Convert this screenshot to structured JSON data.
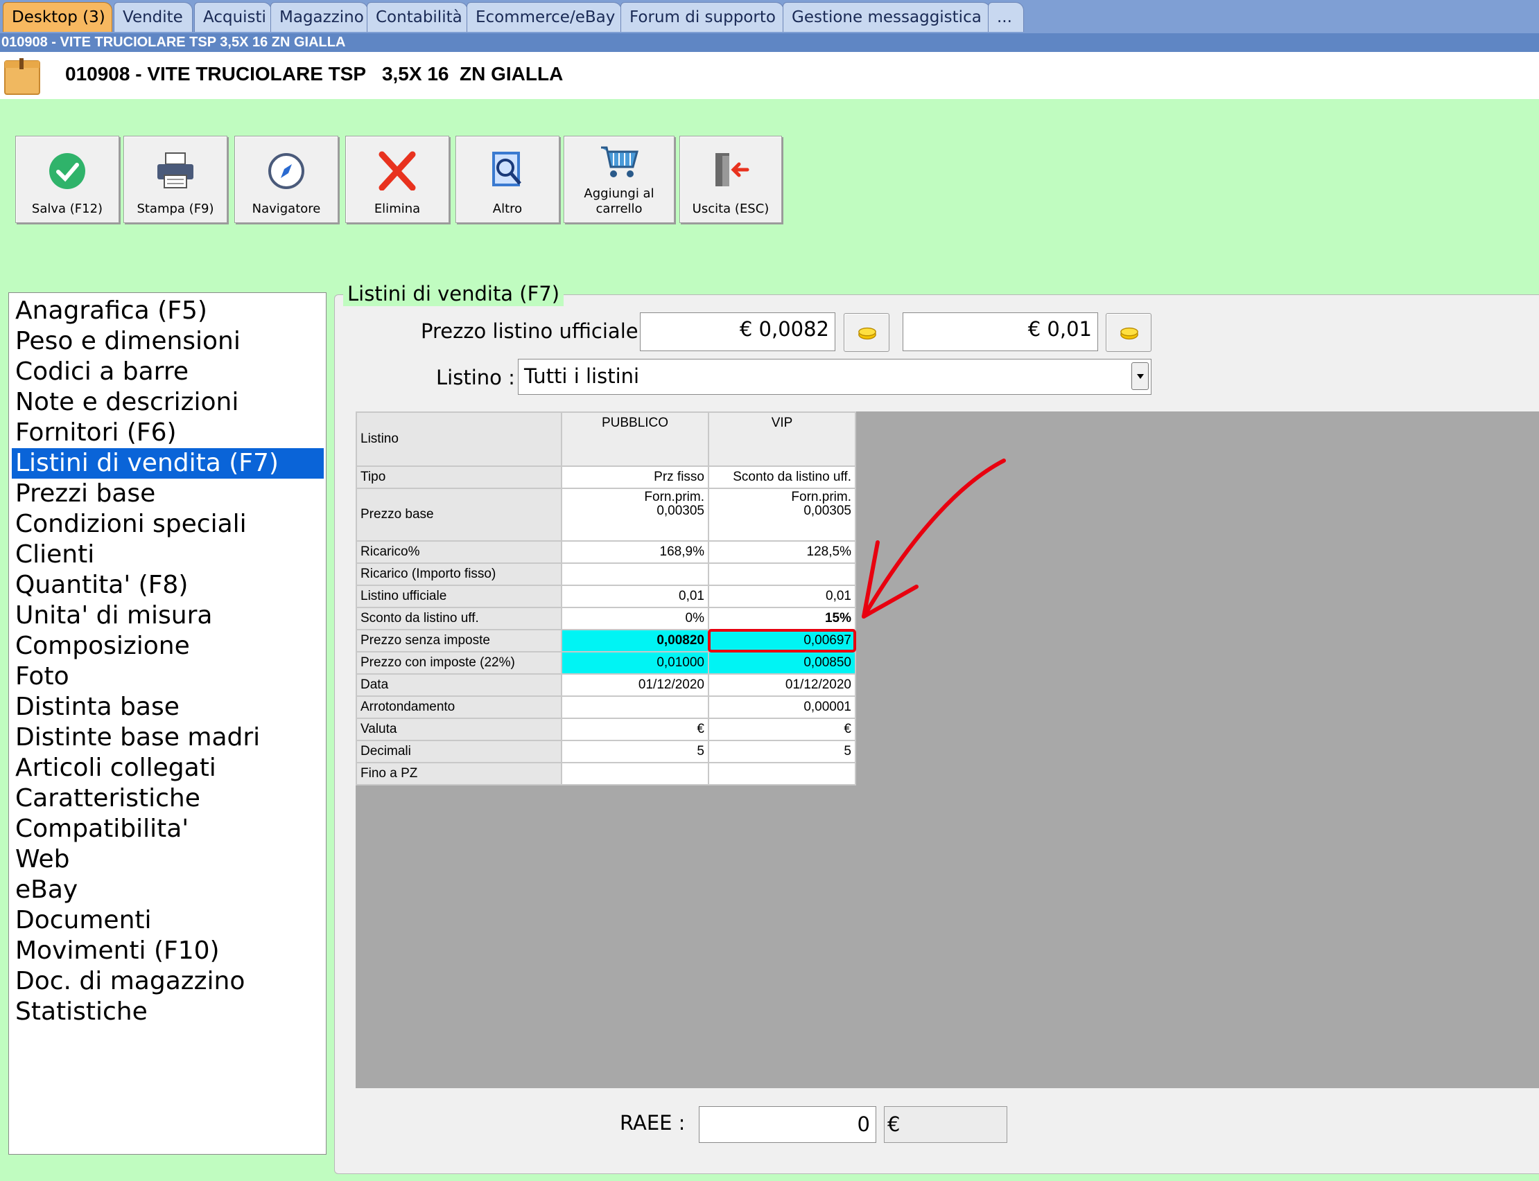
{
  "tabs": [
    {
      "label": "Desktop (3)",
      "active": true
    },
    {
      "label": "Vendite"
    },
    {
      "label": "Acquisti"
    },
    {
      "label": "Magazzino"
    },
    {
      "label": "Contabilità"
    },
    {
      "label": "Ecommerce/eBay"
    },
    {
      "label": "Forum di supporto"
    },
    {
      "label": "Gestione messaggistica"
    },
    {
      "label": "..."
    }
  ],
  "window_title": "010908 - VITE TRUCIOLARE TSP   3,5X 16  ZN GIALLA",
  "header_title": "010908 - VITE TRUCIOLARE TSP   3,5X 16  ZN GIALLA",
  "toolbar": {
    "save": "Salva (F12)",
    "print": "Stampa (F9)",
    "navigator": "Navigatore",
    "delete": "Elimina",
    "other": "Altro",
    "cart_line1": "Aggiungi al",
    "cart_line2": "carrello",
    "exit": "Uscita (ESC)"
  },
  "sidenav": [
    "Anagrafica (F5)",
    "Peso e dimensioni",
    "Codici a barre",
    "Note e descrizioni",
    "Fornitori (F6)",
    "Listini di vendita (F7)",
    "Prezzi base",
    "Condizioni speciali",
    "Clienti",
    "Quantita' (F8)",
    "Unita' di misura",
    "Composizione",
    "Foto",
    "Distinta base",
    "Distinte base madri",
    "Articoli collegati",
    "Caratteristiche",
    "Compatibilita'",
    "Web",
    "eBay",
    "Documenti",
    "Movimenti (F10)",
    "Doc. di magazzino",
    "Statistiche"
  ],
  "selected_nav": "Listini di vendita (F7)",
  "group_title": "Listini di vendita (F7)",
  "official_price_label": "Prezzo listino ufficiale :",
  "official_price_value": "€ 0,0082",
  "official_price_value2": "€ 0,01",
  "listino_label": "Listino :",
  "listino_value": "Tutti i listini",
  "grid": {
    "corner": "Listino",
    "col1": "PUBBLICO",
    "col2": "VIP",
    "rows": {
      "tipo": {
        "label": "Tipo",
        "v1": "Prz fisso",
        "v2": "Sconto da listino uff."
      },
      "prezzo_base": {
        "label": "Prezzo base",
        "v1a": "Forn.prim.",
        "v1b": "0,00305",
        "v2a": "Forn.prim.",
        "v2b": "0,00305"
      },
      "ricarico_pct": {
        "label": "Ricarico%",
        "v1": "168,9%",
        "v2": "128,5%"
      },
      "ricarico_fisso": {
        "label": "Ricarico (Importo fisso)",
        "v1": "",
        "v2": ""
      },
      "listino_uff": {
        "label": "Listino ufficiale",
        "v1": "0,01",
        "v2": "0,01"
      },
      "sconto": {
        "label": "Sconto da listino uff.",
        "v1": "0%",
        "v2": "15%"
      },
      "senza_imposte": {
        "label": "Prezzo senza imposte",
        "v1": "0,00820",
        "v2": "0,00697"
      },
      "con_imposte": {
        "label": "Prezzo con imposte (22%)",
        "v1": "0,01000",
        "v2": "0,00850"
      },
      "data": {
        "label": "Data",
        "v1": "01/12/2020",
        "v2": "01/12/2020"
      },
      "arrotondamento": {
        "label": "Arrotondamento",
        "v1": "",
        "v2": "0,00001"
      },
      "valuta": {
        "label": "Valuta",
        "v1": "€",
        "v2": "€"
      },
      "decimali": {
        "label": "Decimali",
        "v1": "5",
        "v2": "5"
      },
      "fino_a_pz": {
        "label": "Fino a PZ",
        "v1": "",
        "v2": ""
      }
    }
  },
  "raee_label": "RAEE :",
  "raee_value": "0",
  "raee_currency": "€",
  "colors": {
    "background": "#c0fcc0",
    "selection": "#0a64d8",
    "highlight_cells": "#00f4f4",
    "annotation": "#e8000f"
  }
}
